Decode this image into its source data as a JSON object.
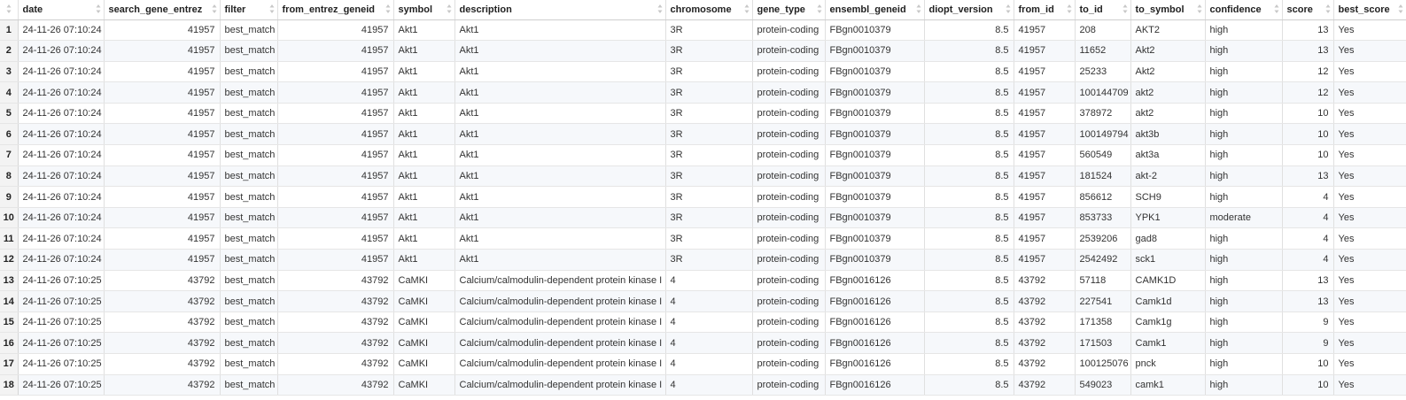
{
  "columns": [
    {
      "label": "",
      "align": "center"
    },
    {
      "label": "date",
      "align": "left"
    },
    {
      "label": "search_gene_entrez",
      "align": "right"
    },
    {
      "label": "filter",
      "align": "left"
    },
    {
      "label": "from_entrez_geneid",
      "align": "right"
    },
    {
      "label": "symbol",
      "align": "left"
    },
    {
      "label": "description",
      "align": "left"
    },
    {
      "label": "chromosome",
      "align": "left"
    },
    {
      "label": "gene_type",
      "align": "left"
    },
    {
      "label": "ensembl_geneid",
      "align": "left"
    },
    {
      "label": "diopt_version",
      "align": "right"
    },
    {
      "label": "from_id",
      "align": "left"
    },
    {
      "label": "to_id",
      "align": "left"
    },
    {
      "label": "to_symbol",
      "align": "left"
    },
    {
      "label": "confidence",
      "align": "left"
    },
    {
      "label": "score",
      "align": "right"
    },
    {
      "label": "best_score",
      "align": "left"
    }
  ],
  "rows": [
    [
      "1",
      "24-11-26 07:10:24",
      "41957",
      "best_match",
      "41957",
      "Akt1",
      "Akt1",
      "3R",
      "protein-coding",
      "FBgn0010379",
      "8.5",
      "41957",
      "208",
      "AKT2",
      "high",
      "13",
      "Yes"
    ],
    [
      "2",
      "24-11-26 07:10:24",
      "41957",
      "best_match",
      "41957",
      "Akt1",
      "Akt1",
      "3R",
      "protein-coding",
      "FBgn0010379",
      "8.5",
      "41957",
      "11652",
      "Akt2",
      "high",
      "13",
      "Yes"
    ],
    [
      "3",
      "24-11-26 07:10:24",
      "41957",
      "best_match",
      "41957",
      "Akt1",
      "Akt1",
      "3R",
      "protein-coding",
      "FBgn0010379",
      "8.5",
      "41957",
      "25233",
      "Akt2",
      "high",
      "12",
      "Yes"
    ],
    [
      "4",
      "24-11-26 07:10:24",
      "41957",
      "best_match",
      "41957",
      "Akt1",
      "Akt1",
      "3R",
      "protein-coding",
      "FBgn0010379",
      "8.5",
      "41957",
      "100144709",
      "akt2",
      "high",
      "12",
      "Yes"
    ],
    [
      "5",
      "24-11-26 07:10:24",
      "41957",
      "best_match",
      "41957",
      "Akt1",
      "Akt1",
      "3R",
      "protein-coding",
      "FBgn0010379",
      "8.5",
      "41957",
      "378972",
      "akt2",
      "high",
      "10",
      "Yes"
    ],
    [
      "6",
      "24-11-26 07:10:24",
      "41957",
      "best_match",
      "41957",
      "Akt1",
      "Akt1",
      "3R",
      "protein-coding",
      "FBgn0010379",
      "8.5",
      "41957",
      "100149794",
      "akt3b",
      "high",
      "10",
      "Yes"
    ],
    [
      "7",
      "24-11-26 07:10:24",
      "41957",
      "best_match",
      "41957",
      "Akt1",
      "Akt1",
      "3R",
      "protein-coding",
      "FBgn0010379",
      "8.5",
      "41957",
      "560549",
      "akt3a",
      "high",
      "10",
      "Yes"
    ],
    [
      "8",
      "24-11-26 07:10:24",
      "41957",
      "best_match",
      "41957",
      "Akt1",
      "Akt1",
      "3R",
      "protein-coding",
      "FBgn0010379",
      "8.5",
      "41957",
      "181524",
      "akt-2",
      "high",
      "13",
      "Yes"
    ],
    [
      "9",
      "24-11-26 07:10:24",
      "41957",
      "best_match",
      "41957",
      "Akt1",
      "Akt1",
      "3R",
      "protein-coding",
      "FBgn0010379",
      "8.5",
      "41957",
      "856612",
      "SCH9",
      "high",
      "4",
      "Yes"
    ],
    [
      "10",
      "24-11-26 07:10:24",
      "41957",
      "best_match",
      "41957",
      "Akt1",
      "Akt1",
      "3R",
      "protein-coding",
      "FBgn0010379",
      "8.5",
      "41957",
      "853733",
      "YPK1",
      "moderate",
      "4",
      "Yes"
    ],
    [
      "11",
      "24-11-26 07:10:24",
      "41957",
      "best_match",
      "41957",
      "Akt1",
      "Akt1",
      "3R",
      "protein-coding",
      "FBgn0010379",
      "8.5",
      "41957",
      "2539206",
      "gad8",
      "high",
      "4",
      "Yes"
    ],
    [
      "12",
      "24-11-26 07:10:24",
      "41957",
      "best_match",
      "41957",
      "Akt1",
      "Akt1",
      "3R",
      "protein-coding",
      "FBgn0010379",
      "8.5",
      "41957",
      "2542492",
      "sck1",
      "high",
      "4",
      "Yes"
    ],
    [
      "13",
      "24-11-26 07:10:25",
      "43792",
      "best_match",
      "43792",
      "CaMKI",
      "Calcium/calmodulin-dependent protein kinase I",
      "4",
      "protein-coding",
      "FBgn0016126",
      "8.5",
      "43792",
      "57118",
      "CAMK1D",
      "high",
      "13",
      "Yes"
    ],
    [
      "14",
      "24-11-26 07:10:25",
      "43792",
      "best_match",
      "43792",
      "CaMKI",
      "Calcium/calmodulin-dependent protein kinase I",
      "4",
      "protein-coding",
      "FBgn0016126",
      "8.5",
      "43792",
      "227541",
      "Camk1d",
      "high",
      "13",
      "Yes"
    ],
    [
      "15",
      "24-11-26 07:10:25",
      "43792",
      "best_match",
      "43792",
      "CaMKI",
      "Calcium/calmodulin-dependent protein kinase I",
      "4",
      "protein-coding",
      "FBgn0016126",
      "8.5",
      "43792",
      "171358",
      "Camk1g",
      "high",
      "9",
      "Yes"
    ],
    [
      "16",
      "24-11-26 07:10:25",
      "43792",
      "best_match",
      "43792",
      "CaMKI",
      "Calcium/calmodulin-dependent protein kinase I",
      "4",
      "protein-coding",
      "FBgn0016126",
      "8.5",
      "43792",
      "171503",
      "Camk1",
      "high",
      "9",
      "Yes"
    ],
    [
      "17",
      "24-11-26 07:10:25",
      "43792",
      "best_match",
      "43792",
      "CaMKI",
      "Calcium/calmodulin-dependent protein kinase I",
      "4",
      "protein-coding",
      "FBgn0016126",
      "8.5",
      "43792",
      "100125076",
      "pnck",
      "high",
      "10",
      "Yes"
    ],
    [
      "18",
      "24-11-26 07:10:25",
      "43792",
      "best_match",
      "43792",
      "CaMKI",
      "Calcium/calmodulin-dependent protein kinase I",
      "4",
      "protein-coding",
      "FBgn0016126",
      "8.5",
      "43792",
      "549023",
      "camk1",
      "high",
      "10",
      "Yes"
    ]
  ]
}
